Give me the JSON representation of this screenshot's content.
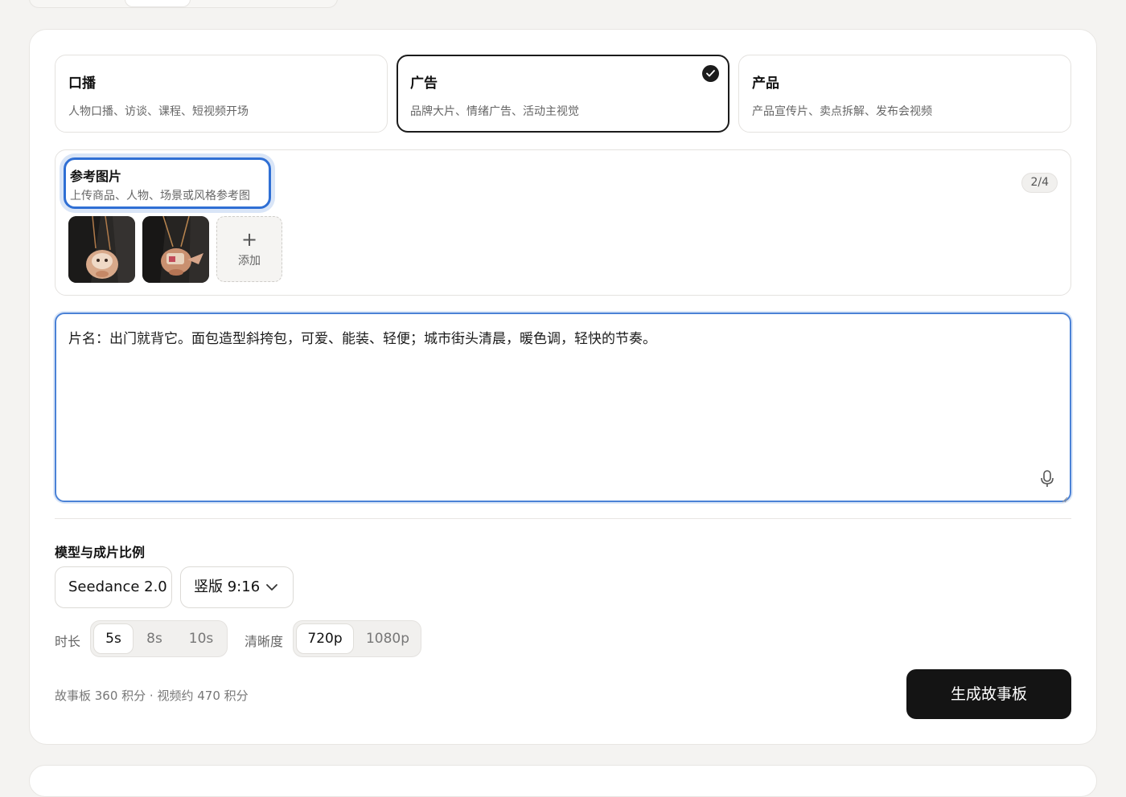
{
  "modes": [
    {
      "title": "口播",
      "desc": "人物口播、访谈、课程、短视频开场",
      "selected": false
    },
    {
      "title": "广告",
      "desc": "品牌大片、情绪广告、活动主视觉",
      "selected": true
    },
    {
      "title": "产品",
      "desc": "产品宣传片、卖点拆解、发布会视频",
      "selected": false
    }
  ],
  "reference": {
    "title": "参考图片",
    "subtitle": "上传商品、人物、场景或风格参考图",
    "counter": "2/4",
    "add_label": "添加",
    "add_symbol": "+"
  },
  "prompt": {
    "value": "片名：出门就背它。面包造型斜挎包，可爱、能装、轻便；城市街头清晨，暖色调，轻快的节奏。"
  },
  "settings": {
    "section_title": "模型与成片比例",
    "model": "Seedance 2.0",
    "ratio": "竖版 9:16",
    "duration_label": "时长",
    "durations": [
      "5s",
      "8s",
      "10s"
    ],
    "duration_selected": "5s",
    "quality_label": "清晰度",
    "qualities": [
      "720p",
      "1080p"
    ],
    "quality_selected": "720p"
  },
  "footer": {
    "cost_text": "故事板 360 积分 · 视频约 470 积分",
    "generate_label": "生成故事板"
  },
  "colors": {
    "accent_blue": "#2f6fd4",
    "primary_button": "#141414",
    "selected_border": "#1b1b1b"
  }
}
